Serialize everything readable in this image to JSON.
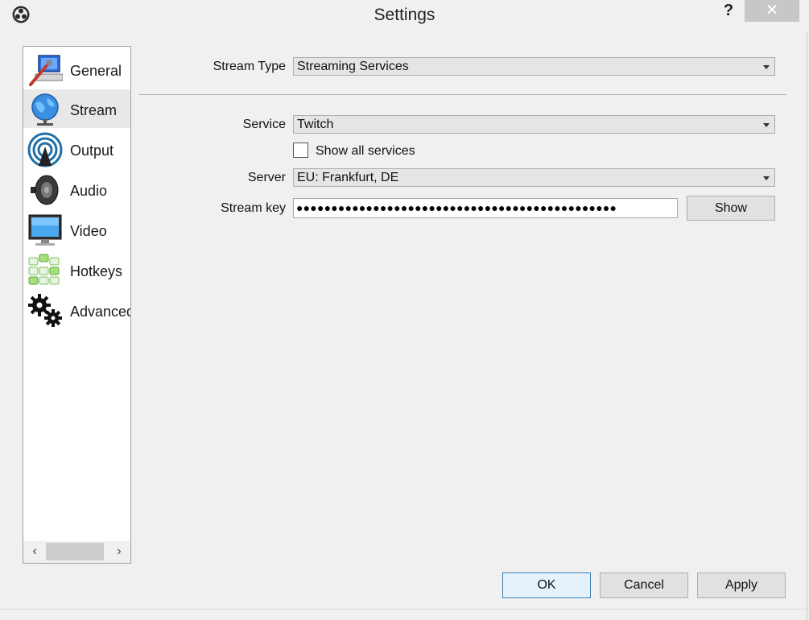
{
  "window": {
    "title": "Settings",
    "help_label": "?",
    "close_label": "✕"
  },
  "sidebar": {
    "items": [
      {
        "label": "General",
        "icon": "general-icon",
        "selected": false
      },
      {
        "label": "Stream",
        "icon": "globe-icon",
        "selected": true
      },
      {
        "label": "Output",
        "icon": "output-icon",
        "selected": false
      },
      {
        "label": "Audio",
        "icon": "speaker-icon",
        "selected": false
      },
      {
        "label": "Video",
        "icon": "monitor-icon",
        "selected": false
      },
      {
        "label": "Hotkeys",
        "icon": "keyboard-icon",
        "selected": false
      },
      {
        "label": "Advanced",
        "icon": "gears-icon",
        "selected": false
      }
    ],
    "scroll_left": "‹",
    "scroll_right": "›"
  },
  "form": {
    "stream_type_label": "Stream Type",
    "stream_type_value": "Streaming Services",
    "service_label": "Service",
    "service_value": "Twitch",
    "show_all_label": "Show all services",
    "show_all_checked": false,
    "server_label": "Server",
    "server_value": "EU: Frankfurt, DE",
    "stream_key_label": "Stream key",
    "stream_key_value": "●●●●●●●●●●●●●●●●●●●●●●●●●●●●●●●●●●●●●●●●●●●●●●",
    "show_button": "Show"
  },
  "footer": {
    "ok": "OK",
    "cancel": "Cancel",
    "apply": "Apply"
  },
  "colors": {
    "accent": "#3c7fb1",
    "selected_bg": "#e8e8e8"
  }
}
